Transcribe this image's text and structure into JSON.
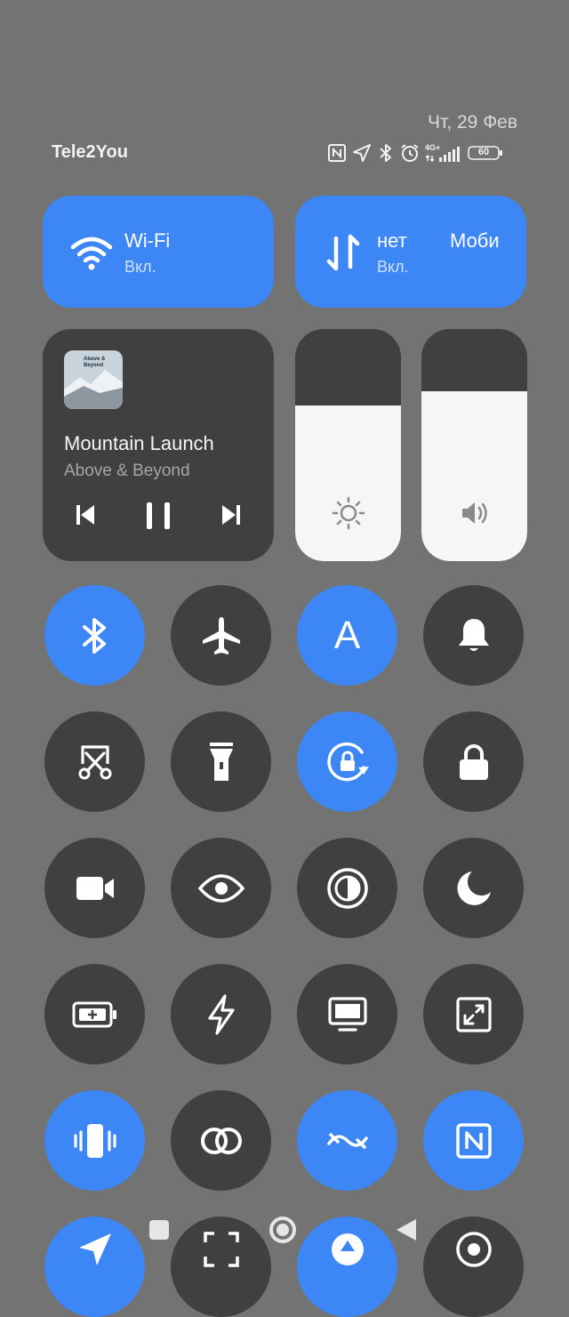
{
  "status_bar": {
    "date": "Чт, 29 Фев",
    "carrier": "Tele2You",
    "icons": [
      "nfc-icon",
      "location-icon",
      "bluetooth-icon",
      "alarm-icon",
      "signal-4g-icon",
      "battery-icon"
    ],
    "network_label": "4G+",
    "battery_level": "60"
  },
  "tiles": {
    "wifi": {
      "title": "Wi-Fi",
      "status": "Вкл.",
      "icon": "wifi-icon"
    },
    "mobile": {
      "title_left": "нет",
      "title_right": "Моби",
      "status": "Вкл.",
      "icon": "mobile-data-icon"
    }
  },
  "media": {
    "album_art_text": "Above & Beyond",
    "title": "Mountain Launch",
    "artist": "Above & Beyond",
    "controls": [
      "previous-icon",
      "pause-icon",
      "next-icon"
    ]
  },
  "sliders": {
    "brightness": {
      "icon": "brightness-icon",
      "level": 0.67
    },
    "volume": {
      "icon": "volume-icon",
      "level": 0.73
    }
  },
  "toggles": [
    {
      "name": "bluetooth",
      "icon": "bluetooth-icon",
      "active": true
    },
    {
      "name": "airplane-mode",
      "icon": "airplane-icon",
      "active": false
    },
    {
      "name": "auto-brightness",
      "icon": "auto-brightness-icon",
      "label": "A",
      "active": true
    },
    {
      "name": "sound",
      "icon": "bell-icon",
      "active": false
    },
    {
      "name": "screenshot",
      "icon": "scissors-icon",
      "active": false
    },
    {
      "name": "flashlight",
      "icon": "flashlight-icon",
      "active": false
    },
    {
      "name": "auto-rotate",
      "icon": "rotation-lock-icon",
      "active": true
    },
    {
      "name": "lock-screen",
      "icon": "lock-icon",
      "active": false
    },
    {
      "name": "screen-recorder",
      "icon": "video-camera-icon",
      "active": false
    },
    {
      "name": "reading-mode",
      "icon": "eye-icon",
      "active": false
    },
    {
      "name": "dark-mode",
      "icon": "contrast-icon",
      "active": false
    },
    {
      "name": "dnd",
      "icon": "moon-icon",
      "active": false
    },
    {
      "name": "battery-saver",
      "icon": "battery-plus-icon",
      "active": false
    },
    {
      "name": "performance",
      "icon": "lightning-icon",
      "active": false
    },
    {
      "name": "cast",
      "icon": "monitor-icon",
      "active": false
    },
    {
      "name": "floating-window",
      "icon": "resize-icon",
      "active": false
    },
    {
      "name": "vibrate",
      "icon": "vibrate-icon",
      "active": true
    },
    {
      "name": "link",
      "icon": "link-icon",
      "active": false
    },
    {
      "name": "hotspot-sync",
      "icon": "hotspot-icon",
      "active": true
    },
    {
      "name": "nfc",
      "icon": "nfc-icon",
      "active": true
    },
    {
      "name": "location",
      "icon": "location-icon",
      "active": true
    },
    {
      "name": "scanner",
      "icon": "scan-icon",
      "active": false
    },
    {
      "name": "data-saver",
      "icon": "data-saver-icon",
      "active": true
    },
    {
      "name": "camera",
      "icon": "camera-icon",
      "active": false
    }
  ],
  "navigation": [
    "recents-icon",
    "home-icon",
    "back-icon"
  ],
  "colors": {
    "accent": "#3d86f5",
    "tile_dark": "#404040",
    "background": "#737373"
  }
}
